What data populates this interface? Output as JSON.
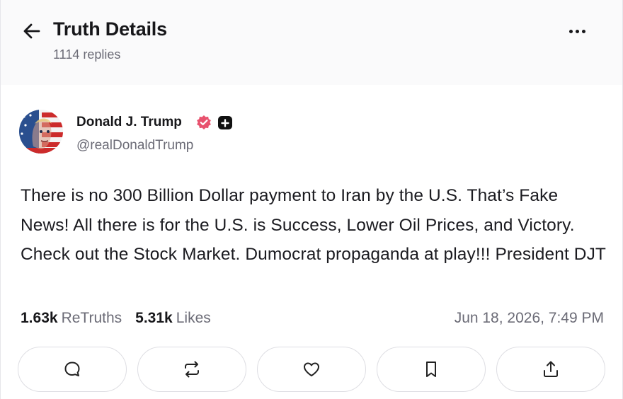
{
  "header": {
    "title": "Truth Details",
    "reply_count": "1114 replies"
  },
  "post": {
    "author_name": "Donald J. Trump",
    "author_handle": "@realDonaldTrump",
    "text": "There is no 300 Billion Dollar payment to Iran by the U.S. That’s Fake News! All there is for the U.S. is Success, Lower Oil Prices, and Victory. Check out the Stock Market. Dumocrat propaganda at play!!! President DJT",
    "retruths_count": "1.63k",
    "retruths_label": "ReTruths",
    "likes_count": "5.31k",
    "likes_label": "Likes",
    "timestamp": "Jun 18, 2026, 7:49 PM"
  },
  "actions": {
    "icons": [
      "reply-icon",
      "retruth-icon",
      "like-icon",
      "bookmark-icon",
      "share-icon"
    ]
  },
  "colors": {
    "verified_badge": "#e8526e",
    "muted_text": "#6b6b76",
    "border": "#dedee3"
  }
}
